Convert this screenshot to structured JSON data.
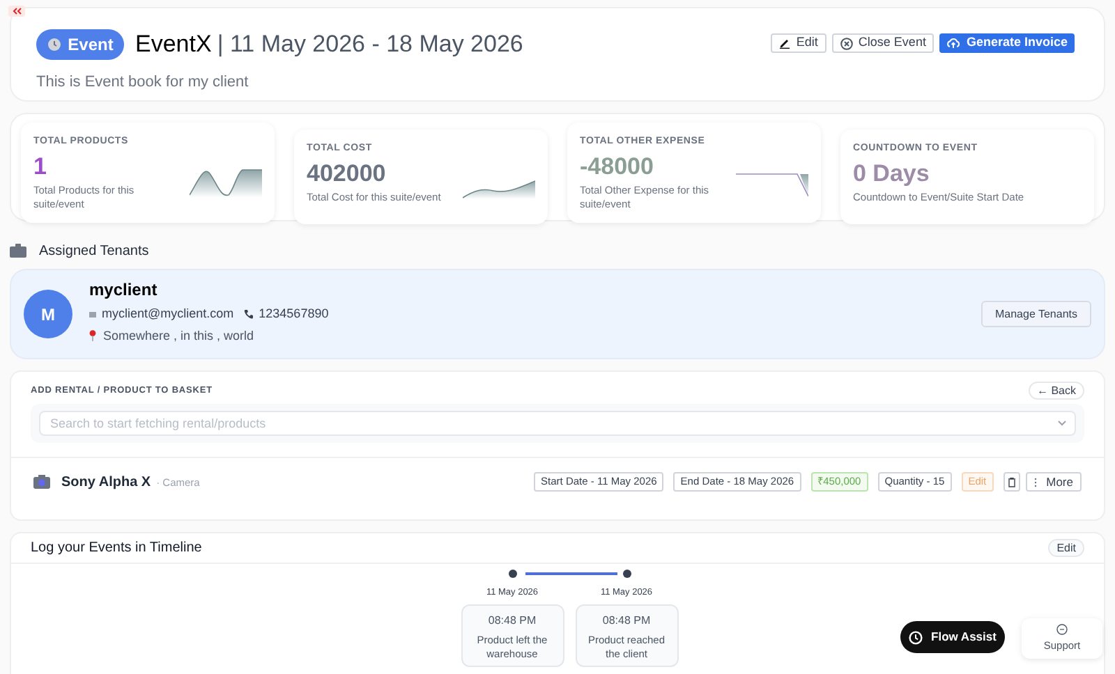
{
  "header": {
    "badge": "Event",
    "title": "EventX",
    "dates": "| 11 May 2026 - 18 May 2026",
    "description": "This is Event book for my client",
    "buttons": [
      {
        "label": "Edit",
        "kind": "edit"
      },
      {
        "label": "Close Event",
        "kind": "close"
      },
      {
        "label": "Generate Invoice",
        "kind": "primary"
      }
    ]
  },
  "stats": [
    {
      "label": "TOTAL PRODUCTS",
      "value": "1",
      "caption": "Total Products for this suite/event",
      "color": "#9b4dca",
      "kind": "wave"
    },
    {
      "label": "TOTAL COST",
      "value": "402000",
      "caption": "Total Cost for this suite/event",
      "color": "#6b7280",
      "kind": "rise"
    },
    {
      "label": "TOTAL OTHER EXPENSE",
      "value": "-48000",
      "caption": "Total Other Expense for this suite/event",
      "color": "#8a9e94",
      "kind": "drop"
    },
    {
      "label": "COUNTDOWN TO EVENT",
      "value": "0 Days",
      "caption": "Countdown to Event/Suite Start Date",
      "color": "#9d8ca8",
      "kind": "none"
    }
  ],
  "tenants": {
    "title": "Assigned Tenants",
    "initial": "M",
    "name": "myclient",
    "email": "myclient@myclient.com",
    "phone": "1234567890",
    "address": "Somewhere , in this , world",
    "button": "Manage Tenants"
  },
  "basket": {
    "title": "ADD RENTAL / PRODUCT TO BASKET",
    "back": "← Back",
    "search": {
      "placeholder": "Search to start fetching rental/products"
    },
    "items": [
      {
        "name": "Sony Alpha X",
        "category": "· Camera",
        "start": "Start Date - 11 May 2026",
        "end": "End Date - 18 May 2026",
        "price": "₹450,000",
        "quantity": "Quantity - 15",
        "edit": "Edit",
        "more": "More"
      }
    ]
  },
  "timeline": {
    "title": "Log your Events in Timeline",
    "edit": "Edit",
    "events": [
      {
        "date": "11 May 2026",
        "time": "08:48 PM",
        "text": "Product left the warehouse"
      },
      {
        "date": "11 May 2026",
        "time": "08:48 PM",
        "text": "Product reached the client"
      }
    ]
  },
  "floating": {
    "assist": "Flow Assist",
    "support": "Support"
  }
}
